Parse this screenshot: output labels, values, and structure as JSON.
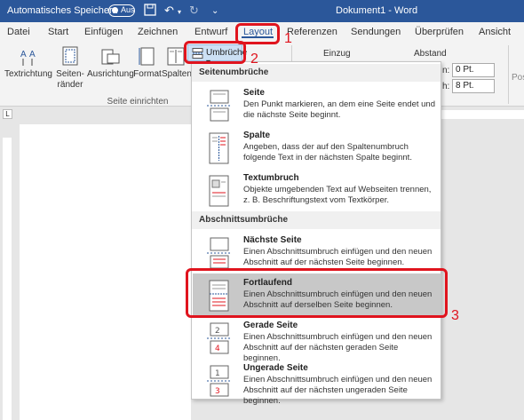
{
  "titlebar": {
    "autosave_label": "Automatisches Speichern",
    "toggle_state": "Aus",
    "document_title": "Dokument1 - Word"
  },
  "tabs": [
    "Datei",
    "Start",
    "Einfügen",
    "Zeichnen",
    "Entwurf",
    "Layout",
    "Referenzen",
    "Sendungen",
    "Überprüfen",
    "Ansicht"
  ],
  "active_tab": "Layout",
  "ribbon": {
    "textrichtung": "Textrichtung",
    "seitenraender_1": "Seiten-",
    "seitenraender_2": "ränder",
    "ausrichtung": "Ausrichtung",
    "format": "Format",
    "spalten": "Spalten",
    "group_label": "Seite einrichten",
    "umbrueche": "Umbrüche",
    "einzug": "Einzug",
    "abstand": "Abstand",
    "spacing_before_label": "n:",
    "spacing_after_label": "h:",
    "spacing_before": "0 Pt.",
    "spacing_after": "8 Pt.",
    "position_label": "Pos"
  },
  "menu": {
    "section1": "Seitenumbrüche",
    "section2": "Abschnittsumbrüche",
    "items": [
      {
        "title": "Seite",
        "desc": "Den Punkt markieren, an dem eine Seite endet und die nächste Seite beginnt."
      },
      {
        "title": "Spalte",
        "desc": "Angeben, dass der auf den Spaltenumbruch folgende Text in der nächsten Spalte beginnt."
      },
      {
        "title": "Textumbruch",
        "desc": "Objekte umgebenden Text auf Webseiten trennen, z. B. Beschriftungstext vom Textkörper."
      },
      {
        "title": "Nächste Seite",
        "desc": "Einen Abschnittsumbruch einfügen und den neuen Abschnitt auf der nächsten Seite beginnen."
      },
      {
        "title": "Fortlaufend",
        "desc": "Einen Abschnittsumbruch einfügen und den neuen Abschnitt auf derselben Seite beginnen."
      },
      {
        "title": "Gerade Seite",
        "desc": "Einen Abschnittsumbruch einfügen und den neuen Abschnitt auf der nächsten geraden Seite beginnen."
      },
      {
        "title": "Ungerade Seite",
        "desc": "Einen Abschnittsumbruch einfügen und den neuen Abschnitt auf der nächsten ungeraden Seite beginnen."
      }
    ]
  },
  "annotations": [
    "1",
    "2",
    "3"
  ],
  "colors": {
    "word_blue": "#2b579a",
    "annotation_red": "#e0141e",
    "highlight": "#c8c8c8"
  }
}
